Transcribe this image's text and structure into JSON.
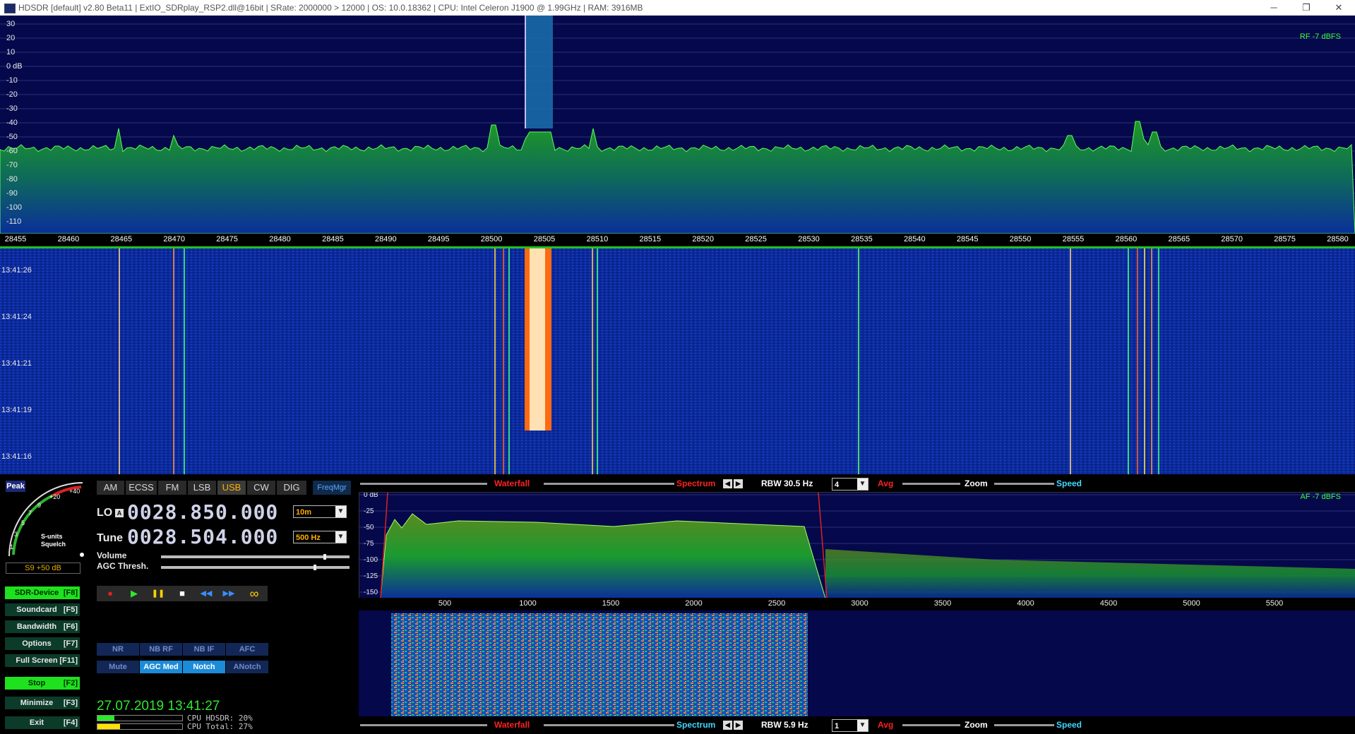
{
  "window": {
    "title": "HDSDR  [default]  v2.80 Beta11  |  ExtIO_SDRplay_RSP2.dll@16bit  |  SRate: 2000000 > 12000  |  OS: 10.0.18362   |  CPU: Intel Celeron  J1900  @ 1.99GHz  |  RAM: 3916MB",
    "min_glyph": "─",
    "max_glyph": "❐",
    "close_glyph": "✕"
  },
  "rf_spectrum": {
    "dbfs_label": "RF  -7 dBFS",
    "db_labels": [
      "30",
      "20",
      "10",
      "0 dB",
      "-10",
      "-20",
      "-30",
      "-40",
      "-50",
      "-60",
      "-70",
      "-80",
      "-90",
      "-100",
      "-110"
    ],
    "freq_labels": [
      "28455",
      "28460",
      "28465",
      "28470",
      "28475",
      "28480",
      "28485",
      "28490",
      "28495",
      "28500",
      "28505",
      "28510",
      "28515",
      "28520",
      "28525",
      "28530",
      "28535",
      "28540",
      "28545",
      "28550",
      "28555",
      "28560",
      "28565",
      "28570",
      "28575",
      "28580"
    ]
  },
  "rf_waterfall": {
    "times": [
      "13:41:26",
      "13:41:24",
      "13:41:21",
      "13:41:19",
      "13:41:16"
    ]
  },
  "smeter": {
    "peak_label": "Peak",
    "scale_labels": [
      "1",
      "3",
      "5",
      "7",
      "9",
      "+20",
      "+40"
    ],
    "caption_line1": "S-units",
    "caption_line2": "Squelch",
    "readout": "S9 +50 dB"
  },
  "side_buttons": [
    {
      "label": "SDR-Device",
      "key": "[F8]",
      "active": true
    },
    {
      "label": "Soundcard",
      "key": "[F5]",
      "active": false
    },
    {
      "label": "Bandwidth",
      "key": "[F6]",
      "active": false
    },
    {
      "label": "Options",
      "key": "[F7]",
      "active": false
    },
    {
      "label": "Full Screen",
      "key": "[F11]",
      "active": false
    },
    {
      "label": "Stop",
      "key": "[F2]",
      "active": true
    },
    {
      "label": "Minimize",
      "key": "[F3]",
      "active": false
    },
    {
      "label": "Exit",
      "key": "[F4]",
      "active": false
    }
  ],
  "modes": [
    "AM",
    "ECSS",
    "FM",
    "LSB",
    "USB",
    "CW",
    "DIG"
  ],
  "selected_mode": "USB",
  "freqmgr_label": "FreqMgr",
  "lo": {
    "label": "LO",
    "a_label": "A",
    "value": "0028.850.000",
    "band": "10m"
  },
  "tune": {
    "label": "Tune",
    "value": "0028.504.000",
    "step": "500 Hz"
  },
  "sliders": {
    "volume_label": "Volume",
    "agc_label": "AGC Thresh.",
    "volume_level": 0.86,
    "agc_level": 0.81
  },
  "transport": {
    "record": "●",
    "play": "▶",
    "pause": "❚❚",
    "stop": "■",
    "rewind": "◀◀",
    "forward": "▶▶",
    "loop": "∞"
  },
  "dsp_row1": [
    {
      "label": "NR",
      "on": false
    },
    {
      "label": "NB RF",
      "on": false
    },
    {
      "label": "NB IF",
      "on": false
    },
    {
      "label": "AFC",
      "on": false
    }
  ],
  "dsp_row2": [
    {
      "label": "Mute",
      "on": false
    },
    {
      "label": "AGC Med",
      "on": true
    },
    {
      "label": "Notch",
      "on": true
    },
    {
      "label": "ANotch",
      "on": false
    }
  ],
  "datetime": "27.07.2019 13:41:27",
  "cpu": {
    "hdsdr_label": "CPU HDSDR: 20%",
    "total_label": "CPU Total: 27%",
    "hdsdr_pct": 0.2,
    "total_pct": 0.27
  },
  "rf_toolbar": {
    "waterfall": "Waterfall",
    "spectrum": "Spectrum",
    "rbw": "RBW 30.5 Hz",
    "avg_value": "4",
    "avg": "Avg",
    "zoom": "Zoom",
    "speed": "Speed"
  },
  "af_toolbar": {
    "waterfall": "Waterfall",
    "spectrum": "Spectrum",
    "rbw": "RBW  5.9 Hz",
    "avg_value": "1",
    "avg": "Avg",
    "zoom": "Zoom",
    "speed": "Speed"
  },
  "af_spectrum": {
    "dbfs_label": "AF  -7 dBFS",
    "db_labels": [
      "0 dB",
      "-25",
      "-50",
      "-75",
      "-100",
      "-125",
      "-150"
    ],
    "freq_labels": [
      "500",
      "1000",
      "1500",
      "2000",
      "2500",
      "3000",
      "3500",
      "4000",
      "4500",
      "5000",
      "5500"
    ]
  },
  "colors": {
    "accent_green": "#23c123",
    "mode_selected": "#ffb000",
    "red_label": "#ff2020",
    "cyan_label": "#40d8ff"
  }
}
